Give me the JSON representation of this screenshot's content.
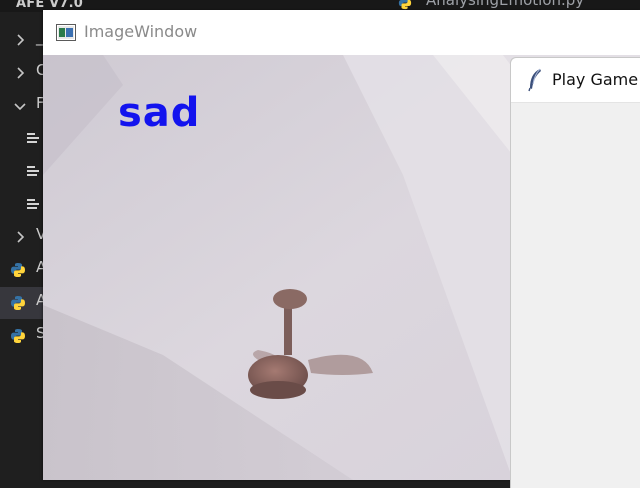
{
  "vscode": {
    "explorer_title": "AFE V7.0",
    "editor_tab_label": "AnalysingEmotion.py",
    "tree_rows": [
      {
        "kind": "folder",
        "expanded": false,
        "peek": "_"
      },
      {
        "kind": "folder",
        "expanded": false,
        "peek": "C"
      },
      {
        "kind": "folder",
        "expanded": true,
        "peek": "F"
      },
      {
        "kind": "file",
        "peek": ""
      },
      {
        "kind": "file",
        "peek": ""
      },
      {
        "kind": "file",
        "peek": ""
      },
      {
        "kind": "folder",
        "expanded": false,
        "peek": "V"
      },
      {
        "kind": "python",
        "peek": "A"
      },
      {
        "kind": "python",
        "peek": "A",
        "selected": true
      },
      {
        "kind": "python",
        "peek": "S"
      }
    ]
  },
  "image_window": {
    "title": "ImageWindow",
    "emotion_label": "sad"
  },
  "play_window": {
    "title": "Play Game"
  },
  "colors": {
    "emotion_text": "#1313ee",
    "python_blue": "#3572a5",
    "python_yellow": "#ffd43b"
  }
}
